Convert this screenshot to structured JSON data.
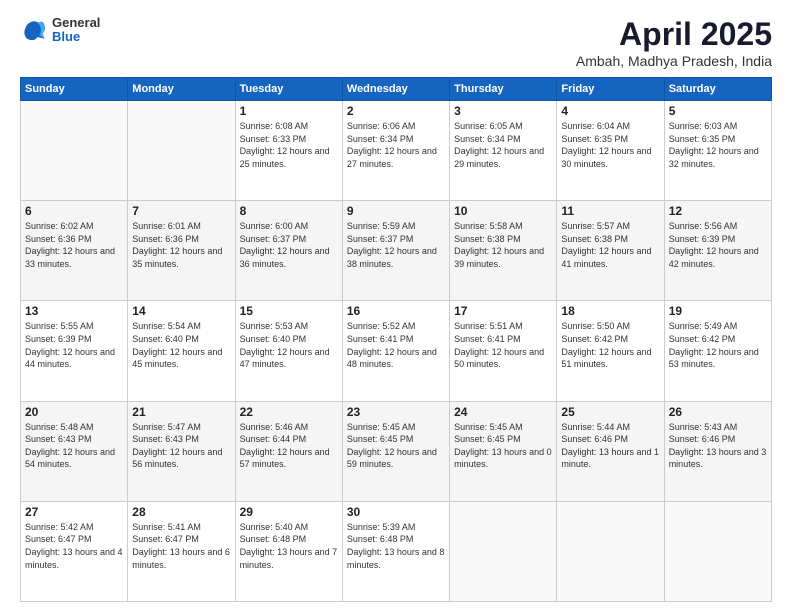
{
  "header": {
    "logo_general": "General",
    "logo_blue": "Blue",
    "title": "April 2025",
    "location": "Ambah, Madhya Pradesh, India"
  },
  "days_of_week": [
    "Sunday",
    "Monday",
    "Tuesday",
    "Wednesday",
    "Thursday",
    "Friday",
    "Saturday"
  ],
  "weeks": [
    [
      {
        "num": "",
        "sunrise": "",
        "sunset": "",
        "daylight": ""
      },
      {
        "num": "",
        "sunrise": "",
        "sunset": "",
        "daylight": ""
      },
      {
        "num": "1",
        "sunrise": "Sunrise: 6:08 AM",
        "sunset": "Sunset: 6:33 PM",
        "daylight": "Daylight: 12 hours and 25 minutes."
      },
      {
        "num": "2",
        "sunrise": "Sunrise: 6:06 AM",
        "sunset": "Sunset: 6:34 PM",
        "daylight": "Daylight: 12 hours and 27 minutes."
      },
      {
        "num": "3",
        "sunrise": "Sunrise: 6:05 AM",
        "sunset": "Sunset: 6:34 PM",
        "daylight": "Daylight: 12 hours and 29 minutes."
      },
      {
        "num": "4",
        "sunrise": "Sunrise: 6:04 AM",
        "sunset": "Sunset: 6:35 PM",
        "daylight": "Daylight: 12 hours and 30 minutes."
      },
      {
        "num": "5",
        "sunrise": "Sunrise: 6:03 AM",
        "sunset": "Sunset: 6:35 PM",
        "daylight": "Daylight: 12 hours and 32 minutes."
      }
    ],
    [
      {
        "num": "6",
        "sunrise": "Sunrise: 6:02 AM",
        "sunset": "Sunset: 6:36 PM",
        "daylight": "Daylight: 12 hours and 33 minutes."
      },
      {
        "num": "7",
        "sunrise": "Sunrise: 6:01 AM",
        "sunset": "Sunset: 6:36 PM",
        "daylight": "Daylight: 12 hours and 35 minutes."
      },
      {
        "num": "8",
        "sunrise": "Sunrise: 6:00 AM",
        "sunset": "Sunset: 6:37 PM",
        "daylight": "Daylight: 12 hours and 36 minutes."
      },
      {
        "num": "9",
        "sunrise": "Sunrise: 5:59 AM",
        "sunset": "Sunset: 6:37 PM",
        "daylight": "Daylight: 12 hours and 38 minutes."
      },
      {
        "num": "10",
        "sunrise": "Sunrise: 5:58 AM",
        "sunset": "Sunset: 6:38 PM",
        "daylight": "Daylight: 12 hours and 39 minutes."
      },
      {
        "num": "11",
        "sunrise": "Sunrise: 5:57 AM",
        "sunset": "Sunset: 6:38 PM",
        "daylight": "Daylight: 12 hours and 41 minutes."
      },
      {
        "num": "12",
        "sunrise": "Sunrise: 5:56 AM",
        "sunset": "Sunset: 6:39 PM",
        "daylight": "Daylight: 12 hours and 42 minutes."
      }
    ],
    [
      {
        "num": "13",
        "sunrise": "Sunrise: 5:55 AM",
        "sunset": "Sunset: 6:39 PM",
        "daylight": "Daylight: 12 hours and 44 minutes."
      },
      {
        "num": "14",
        "sunrise": "Sunrise: 5:54 AM",
        "sunset": "Sunset: 6:40 PM",
        "daylight": "Daylight: 12 hours and 45 minutes."
      },
      {
        "num": "15",
        "sunrise": "Sunrise: 5:53 AM",
        "sunset": "Sunset: 6:40 PM",
        "daylight": "Daylight: 12 hours and 47 minutes."
      },
      {
        "num": "16",
        "sunrise": "Sunrise: 5:52 AM",
        "sunset": "Sunset: 6:41 PM",
        "daylight": "Daylight: 12 hours and 48 minutes."
      },
      {
        "num": "17",
        "sunrise": "Sunrise: 5:51 AM",
        "sunset": "Sunset: 6:41 PM",
        "daylight": "Daylight: 12 hours and 50 minutes."
      },
      {
        "num": "18",
        "sunrise": "Sunrise: 5:50 AM",
        "sunset": "Sunset: 6:42 PM",
        "daylight": "Daylight: 12 hours and 51 minutes."
      },
      {
        "num": "19",
        "sunrise": "Sunrise: 5:49 AM",
        "sunset": "Sunset: 6:42 PM",
        "daylight": "Daylight: 12 hours and 53 minutes."
      }
    ],
    [
      {
        "num": "20",
        "sunrise": "Sunrise: 5:48 AM",
        "sunset": "Sunset: 6:43 PM",
        "daylight": "Daylight: 12 hours and 54 minutes."
      },
      {
        "num": "21",
        "sunrise": "Sunrise: 5:47 AM",
        "sunset": "Sunset: 6:43 PM",
        "daylight": "Daylight: 12 hours and 56 minutes."
      },
      {
        "num": "22",
        "sunrise": "Sunrise: 5:46 AM",
        "sunset": "Sunset: 6:44 PM",
        "daylight": "Daylight: 12 hours and 57 minutes."
      },
      {
        "num": "23",
        "sunrise": "Sunrise: 5:45 AM",
        "sunset": "Sunset: 6:45 PM",
        "daylight": "Daylight: 12 hours and 59 minutes."
      },
      {
        "num": "24",
        "sunrise": "Sunrise: 5:45 AM",
        "sunset": "Sunset: 6:45 PM",
        "daylight": "Daylight: 13 hours and 0 minutes."
      },
      {
        "num": "25",
        "sunrise": "Sunrise: 5:44 AM",
        "sunset": "Sunset: 6:46 PM",
        "daylight": "Daylight: 13 hours and 1 minute."
      },
      {
        "num": "26",
        "sunrise": "Sunrise: 5:43 AM",
        "sunset": "Sunset: 6:46 PM",
        "daylight": "Daylight: 13 hours and 3 minutes."
      }
    ],
    [
      {
        "num": "27",
        "sunrise": "Sunrise: 5:42 AM",
        "sunset": "Sunset: 6:47 PM",
        "daylight": "Daylight: 13 hours and 4 minutes."
      },
      {
        "num": "28",
        "sunrise": "Sunrise: 5:41 AM",
        "sunset": "Sunset: 6:47 PM",
        "daylight": "Daylight: 13 hours and 6 minutes."
      },
      {
        "num": "29",
        "sunrise": "Sunrise: 5:40 AM",
        "sunset": "Sunset: 6:48 PM",
        "daylight": "Daylight: 13 hours and 7 minutes."
      },
      {
        "num": "30",
        "sunrise": "Sunrise: 5:39 AM",
        "sunset": "Sunset: 6:48 PM",
        "daylight": "Daylight: 13 hours and 8 minutes."
      },
      {
        "num": "",
        "sunrise": "",
        "sunset": "",
        "daylight": ""
      },
      {
        "num": "",
        "sunrise": "",
        "sunset": "",
        "daylight": ""
      },
      {
        "num": "",
        "sunrise": "",
        "sunset": "",
        "daylight": ""
      }
    ]
  ]
}
